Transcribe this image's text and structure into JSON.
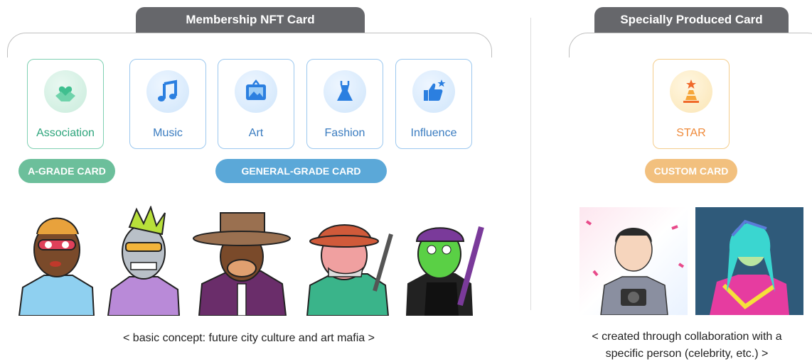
{
  "membership": {
    "title": "Membership NFT Card",
    "cards": [
      {
        "label": "Association",
        "icon": "heart-hands-icon"
      },
      {
        "label": "Music",
        "icon": "music-note-icon"
      },
      {
        "label": "Art",
        "icon": "picture-frame-icon"
      },
      {
        "label": "Fashion",
        "icon": "dress-icon"
      },
      {
        "label": "Influence",
        "icon": "thumbs-up-star-icon"
      }
    ],
    "grade_a": "A-GRADE CARD",
    "grade_general": "GENERAL-GRADE CARD",
    "caption": "< basic concept: future city culture and art mafia >"
  },
  "special": {
    "title": "Specially Produced Card",
    "card": {
      "label": "STAR",
      "icon": "star-pyramid-icon"
    },
    "grade_custom": "CUSTOM CARD",
    "caption_line1": "< created through collaboration with a",
    "caption_line2": "specific person (celebrity, etc.) >"
  },
  "colors": {
    "tab_bg": "#66676b",
    "green": "#6cbf9b",
    "blue": "#5ba8d8",
    "orange": "#f2c07e",
    "blue_text": "#3a7cc0",
    "green_text": "#2ea57c",
    "orange_text": "#ef8a3a"
  }
}
